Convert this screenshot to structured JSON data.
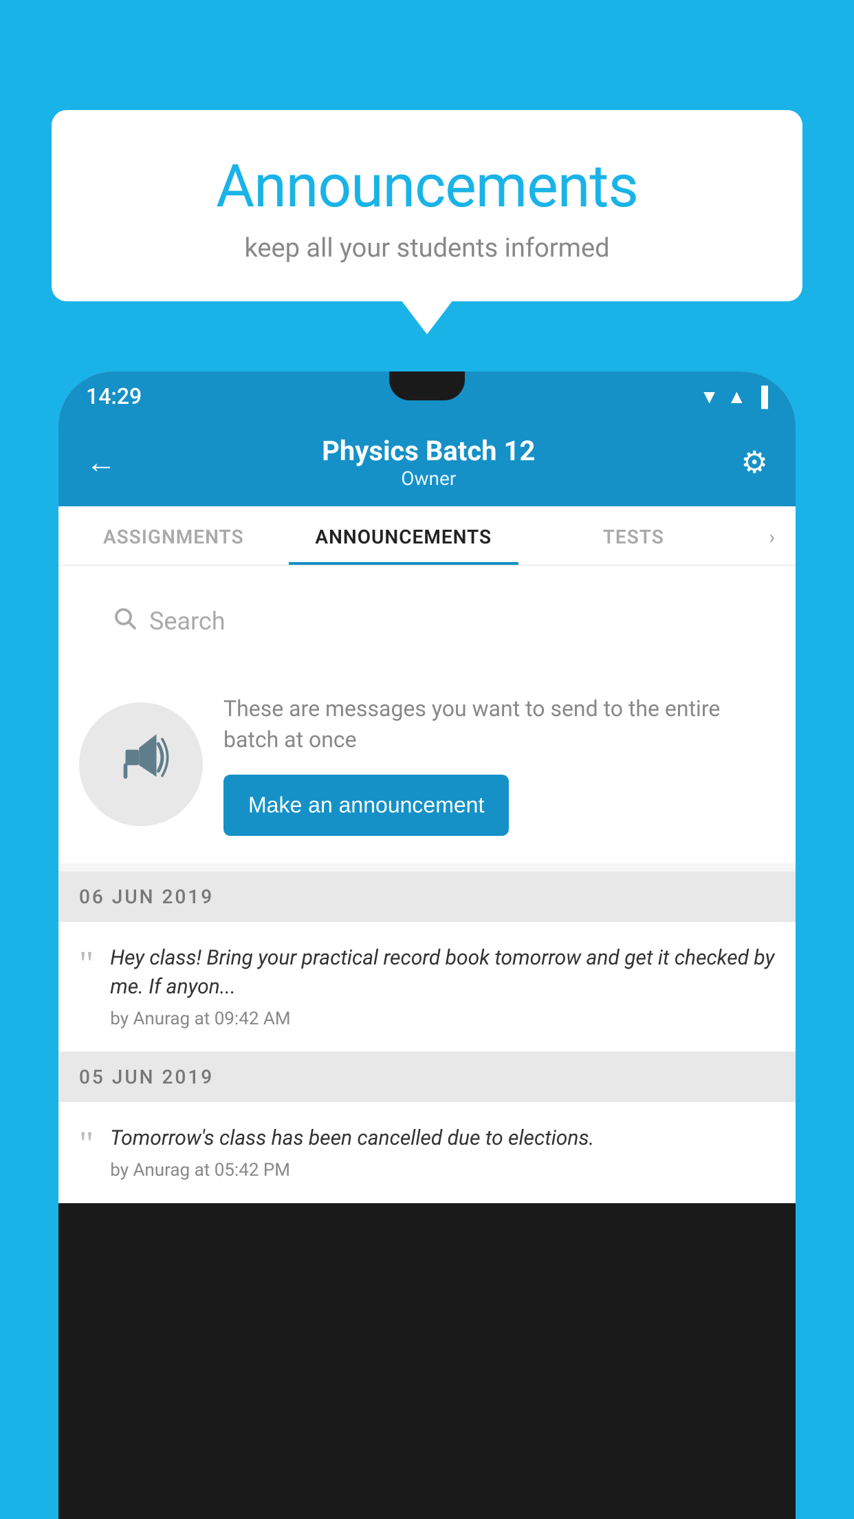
{
  "page": {
    "background_color": "#1ab3e8"
  },
  "speech_bubble": {
    "title": "Announcements",
    "subtitle": "keep all your students informed"
  },
  "status_bar": {
    "time": "14:29",
    "wifi": "▲",
    "signal": "▲",
    "battery": "▪"
  },
  "app_header": {
    "title": "Physics Batch 12",
    "subtitle": "Owner",
    "back_label": "←",
    "gear_label": "⚙"
  },
  "tabs": [
    {
      "label": "ASSIGNMENTS",
      "active": false
    },
    {
      "label": "ANNOUNCEMENTS",
      "active": true
    },
    {
      "label": "TESTS",
      "active": false
    }
  ],
  "search": {
    "placeholder": "Search"
  },
  "announcement_prompt": {
    "description_text": "These are messages you want to send to the entire batch at once",
    "button_label": "Make an announcement"
  },
  "date_sections": [
    {
      "date": "06  JUN  2019",
      "announcements": [
        {
          "text": "Hey class! Bring your practical record book tomorrow and get it checked by me. If anyon...",
          "meta": "by Anurag at 09:42 AM"
        }
      ]
    },
    {
      "date": "05  JUN  2019",
      "announcements": [
        {
          "text": "Tomorrow's class has been cancelled due to elections.",
          "meta": "by Anurag at 05:42 PM"
        }
      ]
    }
  ]
}
